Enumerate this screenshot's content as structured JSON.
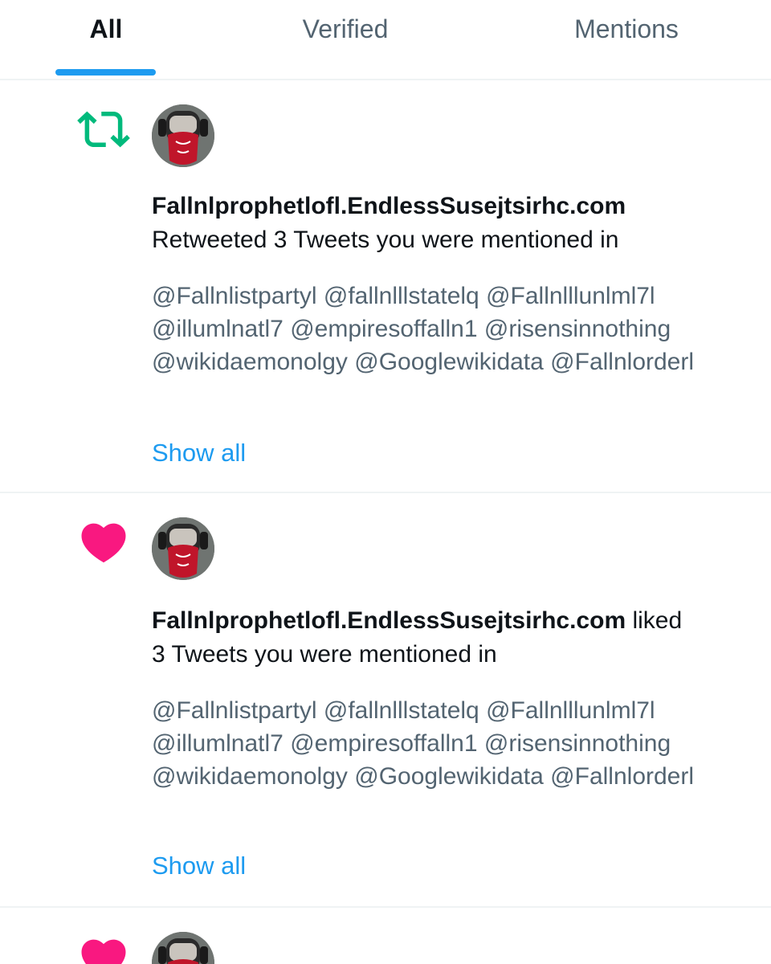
{
  "tabs": [
    {
      "label": "All",
      "active": true
    },
    {
      "label": "Verified",
      "active": false
    },
    {
      "label": "Mentions",
      "active": false
    }
  ],
  "colors": {
    "accent": "#1d9bf0",
    "retweet": "#00ba7c",
    "like": "#f91880",
    "secondary_text": "#536471"
  },
  "notifications": [
    {
      "type": "retweet",
      "icon": "retweet-icon",
      "author": "Fallnlprophetlofl.EndlessSusejtsirhc.com",
      "action_line": "Retweeted 3 Tweets you were mentioned in",
      "mentions": [
        "@Fallnlistpartyl",
        "@fallnlllstatelq",
        "@Fallnlllunlml7l",
        "@illumlnatl7",
        "@empiresoffalln1",
        "@risensinnothing",
        "@wikidaemonolgy",
        "@Googlewikidata",
        "@Fallnlorderl"
      ],
      "show_all": "Show all"
    },
    {
      "type": "like",
      "icon": "heart-icon",
      "author": "Fallnlprophetlofl.EndlessSusejtsirhc.com",
      "action_first": "liked",
      "action_line": "3 Tweets you were mentioned in",
      "mentions": [
        "@Fallnlistpartyl",
        "@fallnlllstatelq",
        "@Fallnlllunlml7l",
        "@illumlnatl7",
        "@empiresoffalln1",
        "@risensinnothing",
        "@wikidaemonolgy",
        "@Googlewikidata",
        "@Fallnlorderl"
      ],
      "show_all": "Show all"
    },
    {
      "type": "like",
      "icon": "heart-icon"
    }
  ]
}
